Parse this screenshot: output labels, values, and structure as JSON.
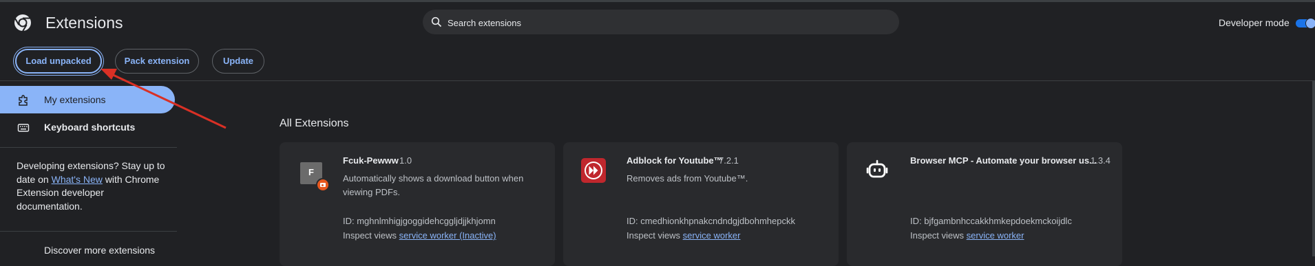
{
  "header": {
    "title": "Extensions",
    "search_placeholder": "Search extensions",
    "developer_mode_label": "Developer mode",
    "developer_mode_on": true
  },
  "toolbar": {
    "load_unpacked": "Load unpacked",
    "pack_extension": "Pack extension",
    "update": "Update"
  },
  "sidebar": {
    "items": [
      {
        "label": "My extensions",
        "icon": "extension-puzzle-icon",
        "active": true
      },
      {
        "label": "Keyboard shortcuts",
        "icon": "keyboard-icon",
        "active": false
      }
    ],
    "promo_text_1": "Developing extensions? Stay up to date on ",
    "promo_link": "What's New",
    "promo_text_2": " with Chrome Extension developer documentation.",
    "discover": "Discover more extensions"
  },
  "main": {
    "section_title": "All Extensions",
    "cards": [
      {
        "name": "Fcuk-Pewww",
        "version": "1.0",
        "icon_letter": "F",
        "description": "Automatically shows a download button when viewing PDFs.",
        "id_label": "ID: mghnlmhigjgoggidehcggljdjjkhjomn",
        "inspect_label": "Inspect views",
        "inspect_link": "service worker (Inactive)"
      },
      {
        "name": "Adblock for Youtube™",
        "version": "7.2.1",
        "description": "Removes ads from Youtube™.",
        "id_label": "ID: cmedhionkhpnakcndndgjdbohmhepckk",
        "inspect_label": "Inspect views",
        "inspect_link": "service worker"
      },
      {
        "name": "Browser MCP - Automate your browser us...",
        "version": "1.3.4",
        "description": "",
        "id_label": "ID: bjfgambnhccakkhmkepdoekmckoijdlc",
        "inspect_label": "Inspect views",
        "inspect_link": "service worker"
      }
    ]
  },
  "colors": {
    "background": "#202124",
    "accent": "#8ab4f8",
    "card": "#292a2d",
    "annotation_arrow": "#d93025"
  }
}
